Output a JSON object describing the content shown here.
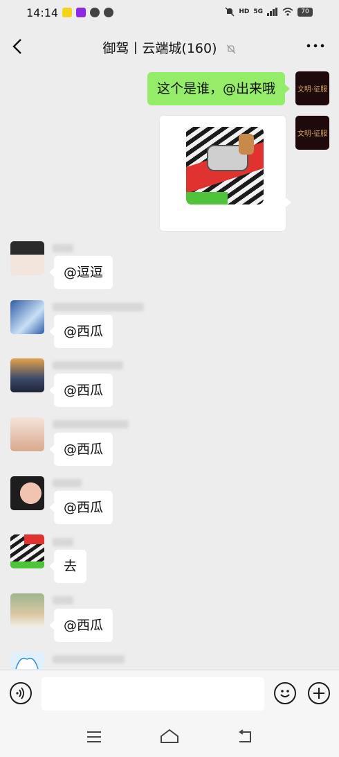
{
  "status_bar": {
    "time": "14:14",
    "network": "5G",
    "battery": "70"
  },
  "header": {
    "title": "御驾丨云端城(160)"
  },
  "messages": [
    {
      "side": "right",
      "type": "text",
      "text": "这个是谁，@出来哦",
      "avatar_text": "文明·征服"
    },
    {
      "side": "right",
      "type": "image",
      "avatar_text": "文明·征服"
    },
    {
      "side": "left",
      "text": "@逗逗"
    },
    {
      "side": "left",
      "text": "@西瓜"
    },
    {
      "side": "left",
      "text": "@西瓜"
    },
    {
      "side": "left",
      "text": "@西瓜"
    },
    {
      "side": "left",
      "text": "@西瓜"
    },
    {
      "side": "left",
      "text": "去"
    },
    {
      "side": "left",
      "text": "@西瓜"
    }
  ],
  "input_bar": {
    "voice_icon": "voice-icon",
    "emoji_icon": "emoji-icon",
    "plus_icon": "plus-icon",
    "value": ""
  },
  "colors": {
    "self_bubble": "#95ec69",
    "background": "#ededed"
  }
}
